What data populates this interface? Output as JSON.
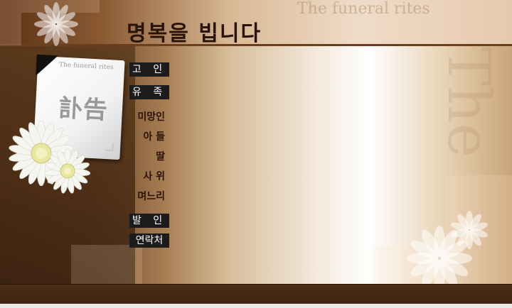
{
  "header": {
    "title": "명복을 빕니다",
    "brand": "The funeral rites",
    "side_brand": "The"
  },
  "card": {
    "subtitle": "The funeral rites",
    "hanja": "訃告"
  },
  "menu": {
    "deceased": "고 인",
    "family": "유 족",
    "widow": "미망인",
    "son": "아 들",
    "daughter": "딸",
    "son_in_law": "사 위",
    "daughter_in_law": "며느리",
    "procession": "발 인",
    "contact": "연락처"
  },
  "colors": {
    "button_bg": "#1c1c1c",
    "title_text": "#2a1408",
    "accent_brown": "#6b3e1d"
  }
}
